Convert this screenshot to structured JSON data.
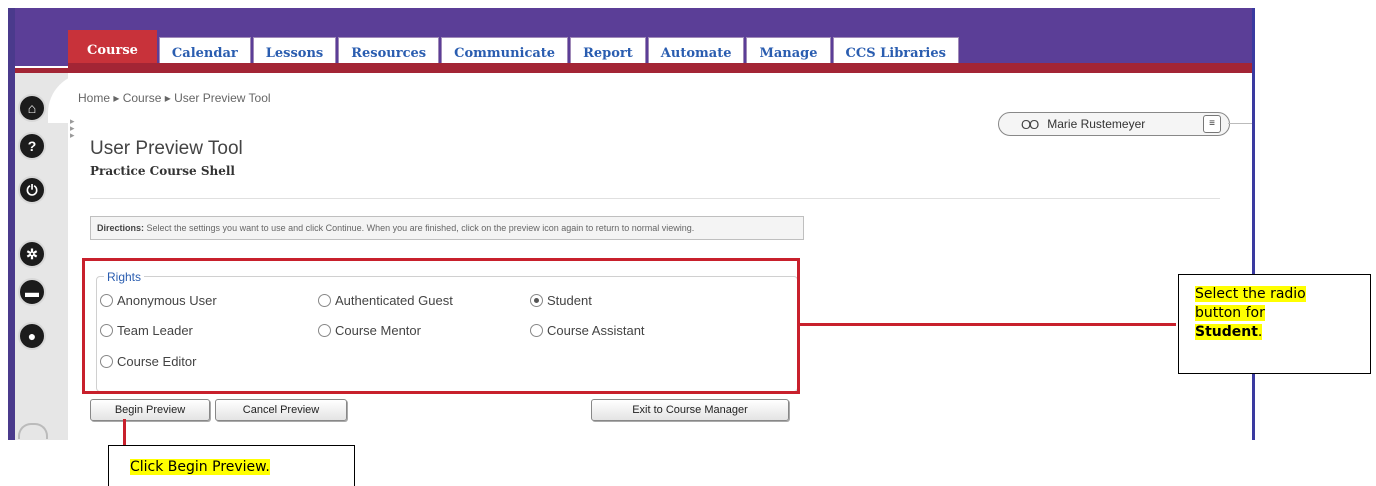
{
  "tabs": [
    {
      "label": "Course",
      "active": true
    },
    {
      "label": "Calendar",
      "active": false
    },
    {
      "label": "Lessons",
      "active": false
    },
    {
      "label": "Resources",
      "active": false
    },
    {
      "label": "Communicate",
      "active": false
    },
    {
      "label": "Report",
      "active": false
    },
    {
      "label": "Automate",
      "active": false
    },
    {
      "label": "Manage",
      "active": false
    },
    {
      "label": "CCS Libraries",
      "active": false
    }
  ],
  "breadcrumb": "Home ▸ Course ▸ User Preview Tool",
  "user": {
    "name": "Marie Rustemeyer",
    "icon": "glasses-icon"
  },
  "page": {
    "title": "User Preview Tool",
    "subtitle": "Practice Course Shell"
  },
  "directions": {
    "label": "Directions:",
    "text": " Select the settings you want to use and click Continue. When you are finished, click on the preview icon again to return to normal viewing."
  },
  "rights": {
    "legend": "Rights",
    "options": [
      {
        "label": "Anonymous User",
        "selected": false
      },
      {
        "label": "Authenticated Guest",
        "selected": false
      },
      {
        "label": "Student",
        "selected": true
      },
      {
        "label": "Team Leader",
        "selected": false
      },
      {
        "label": "Course Mentor",
        "selected": false
      },
      {
        "label": "Course Assistant",
        "selected": false
      },
      {
        "label": "Course Editor",
        "selected": false
      }
    ]
  },
  "buttons": {
    "begin": "Begin Preview",
    "cancel": "Cancel Preview",
    "exit": "Exit to Course Manager"
  },
  "sidebar_icons": [
    "home-icon",
    "help-icon",
    "power-icon",
    "gear-icon",
    "folder-icon",
    "profile-icon"
  ],
  "callouts": {
    "student_line1": "Select the radio",
    "student_line2": "button for",
    "student_line3": "Student",
    "student_period": ".",
    "begin": "Click Begin Preview."
  },
  "colors": {
    "header_purple": "#5b3e97",
    "maroon": "#a32535",
    "active_tab": "#c8323a",
    "tab_text": "#2a5db0",
    "highlight": "#ffff00",
    "callout_red": "#c8202c"
  }
}
